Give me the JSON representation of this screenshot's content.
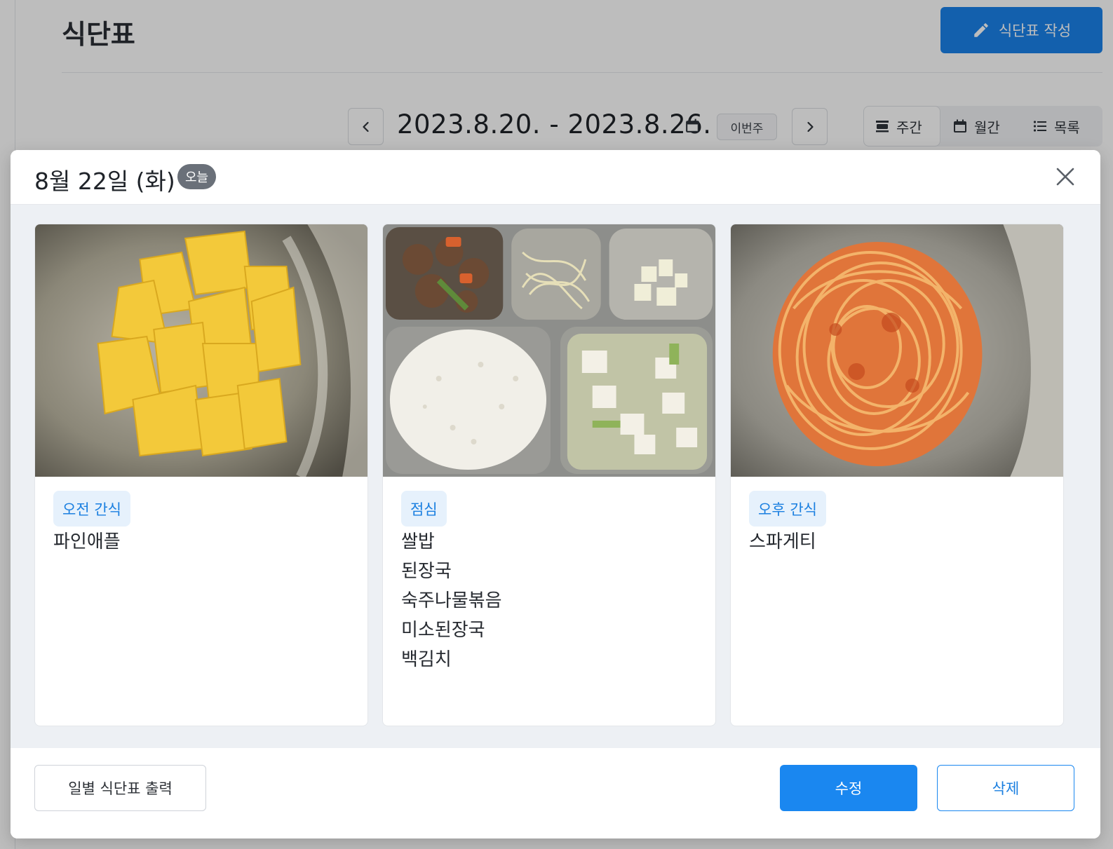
{
  "page": {
    "title": "식단표",
    "create_button_label": "식단표 작성",
    "date_range": "2023.8.20. - 2023.8.26.",
    "this_week_label": "이번주",
    "views": [
      {
        "label": "주간",
        "icon": "week-view-icon",
        "active": true
      },
      {
        "label": "월간",
        "icon": "calendar-icon",
        "active": false
      },
      {
        "label": "목록",
        "icon": "list-icon",
        "active": false
      }
    ],
    "accent_color": "#1a82ea"
  },
  "modal": {
    "date": "8월 22일 (화)",
    "today_badge": "오늘",
    "meals": [
      {
        "tag": "오전 간식",
        "items": [
          "파인애플"
        ],
        "photo": "pineapple-photo"
      },
      {
        "tag": "점심",
        "items": [
          "쌀밥",
          "된장국",
          "숙주나물볶음",
          "미소된장국",
          "백김치"
        ],
        "photo": "lunch-tray-photo"
      },
      {
        "tag": "오후 간식",
        "items": [
          "스파게티"
        ],
        "photo": "spaghetti-photo"
      }
    ],
    "footer": {
      "print_label": "일별 식단표 출력",
      "edit_label": "수정",
      "delete_label": "삭제"
    }
  }
}
